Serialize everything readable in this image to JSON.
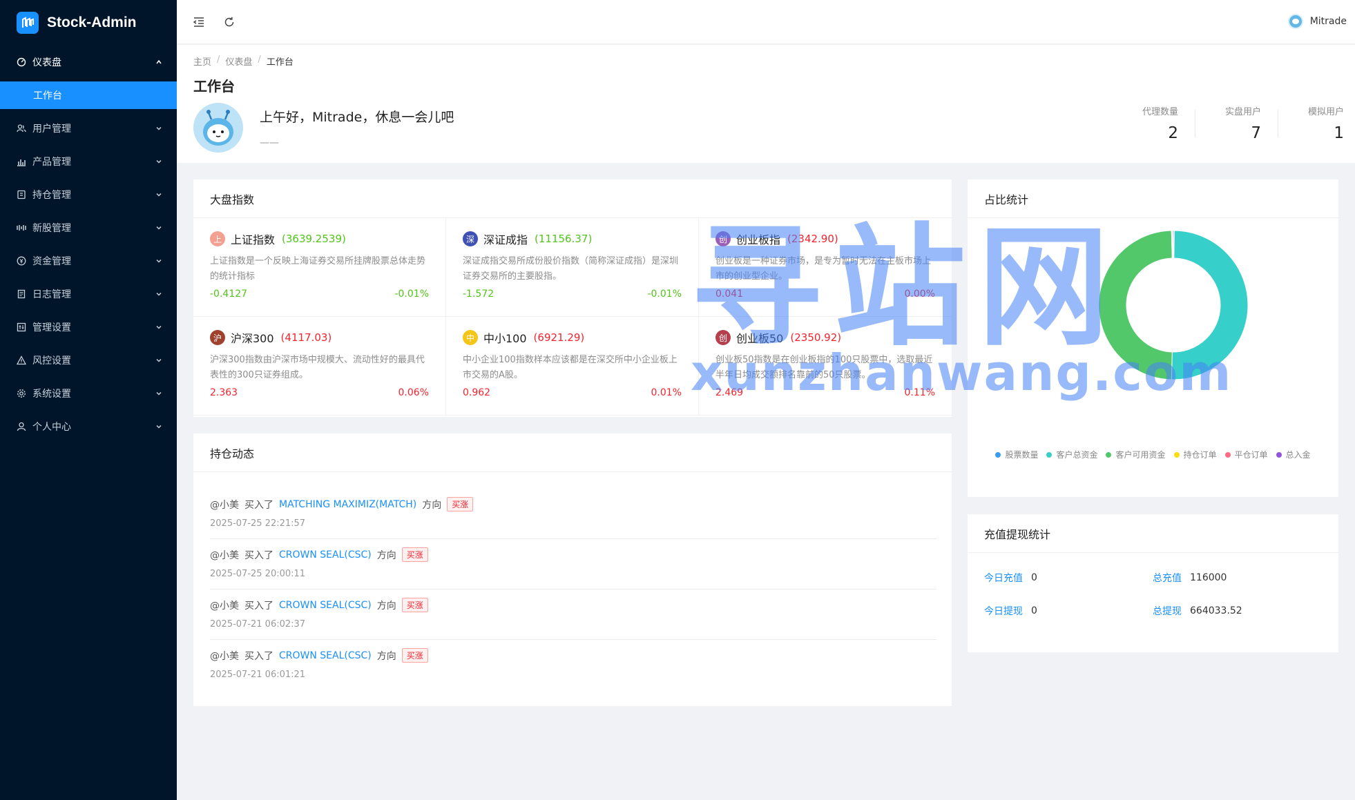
{
  "app": {
    "name": "Stock-Admin"
  },
  "sidebar": {
    "items": [
      {
        "label": "仪表盘",
        "icon": "dashboard-icon",
        "open": true
      },
      {
        "label": "用户管理",
        "icon": "users-icon"
      },
      {
        "label": "产品管理",
        "icon": "bar-chart-icon"
      },
      {
        "label": "持仓管理",
        "icon": "wallet-icon"
      },
      {
        "label": "新股管理",
        "icon": "new-stock-icon"
      },
      {
        "label": "资金管理",
        "icon": "money-icon"
      },
      {
        "label": "日志管理",
        "icon": "log-icon"
      },
      {
        "label": "管理设置",
        "icon": "settings-grid-icon"
      },
      {
        "label": "风控设置",
        "icon": "warning-icon"
      },
      {
        "label": "系统设置",
        "icon": "gear-icon"
      },
      {
        "label": "个人中心",
        "icon": "person-icon"
      }
    ],
    "submenu": {
      "label": "工作台"
    }
  },
  "header": {
    "username": "Mitrade"
  },
  "breadcrumb": [
    "主页",
    "仪表盘",
    "工作台"
  ],
  "page": {
    "title": "工作台",
    "greeting": "上午好，Mitrade，休息一会儿吧",
    "greeting_sub": "——",
    "stats": [
      {
        "label": "代理数量",
        "value": "2"
      },
      {
        "label": "实盘用户",
        "value": "7"
      },
      {
        "label": "模拟用户",
        "value": "1"
      }
    ]
  },
  "market": {
    "title": "大盘指数",
    "indices": [
      {
        "badge": "上",
        "badge_color": "#f4a090",
        "name": "上证指数",
        "price": "(3639.2539)",
        "desc": "上证指数是一个反映上海证券交易所挂牌股票总体走势的统计指标",
        "change": "-0.4127",
        "pct": "-0.01%",
        "trend": "down"
      },
      {
        "badge": "深",
        "badge_color": "#3f51b5",
        "name": "深证成指",
        "price": "(11156.37)",
        "desc": "深证成指交易所成份股价指数（简称深证成指）是深圳证券交易所的主要股指。",
        "change": "-1.572",
        "pct": "-0.01%",
        "trend": "down"
      },
      {
        "badge": "创",
        "badge_color": "#9c5fb5",
        "name": "创业板指",
        "price": "(2342.90)",
        "desc": "创业板是一种证券市场，是专为暂时无法在主板市场上市的创业型企业。",
        "change": "0.041",
        "pct": "0.00%",
        "trend": "up"
      },
      {
        "badge": "沪",
        "badge_color": "#a0412d",
        "name": "沪深300",
        "price": "(4117.03)",
        "desc": "沪深300指数由沪深市场中规模大、流动性好的最具代表性的300只证券组成。",
        "change": "2.363",
        "pct": "0.06%",
        "trend": "up"
      },
      {
        "badge": "中",
        "badge_color": "#f5c518",
        "name": "中小100",
        "price": "(6921.29)",
        "desc": "中小企业100指数样本应该都是在深交所中小企业板上市交易的A股。",
        "change": "0.962",
        "pct": "0.01%",
        "trend": "up"
      },
      {
        "badge": "创",
        "badge_color": "#b5404d",
        "name": "创业板50",
        "price": "(2350.92)",
        "desc": "创业板50指数是在创业板指的100只股票中，选取最近半年日均成交额排名靠前的50只股票。",
        "change": "2.469",
        "pct": "0.11%",
        "trend": "up"
      }
    ]
  },
  "positions": {
    "title": "持仓动态",
    "items": [
      {
        "user": "@小美",
        "action": "买入了",
        "product": "MATCHING MAXIMIZ(MATCH)",
        "dir_label": "方向",
        "tag": "买涨",
        "time": "2025-07-25 22:21:57"
      },
      {
        "user": "@小美",
        "action": "买入了",
        "product": "CROWN SEAL(CSC)",
        "dir_label": "方向",
        "tag": "买涨",
        "time": "2025-07-25 20:00:11"
      },
      {
        "user": "@小美",
        "action": "买入了",
        "product": "CROWN SEAL(CSC)",
        "dir_label": "方向",
        "tag": "买涨",
        "time": "2025-07-21 06:02:37"
      },
      {
        "user": "@小美",
        "action": "买入了",
        "product": "CROWN SEAL(CSC)",
        "dir_label": "方向",
        "tag": "买涨",
        "time": "2025-07-21 06:01:21"
      }
    ]
  },
  "ratio": {
    "title": "占比统计",
    "legend": [
      {
        "label": "股票数量",
        "color": "#3a9cf5"
      },
      {
        "label": "客户总资金",
        "color": "#36cfc9"
      },
      {
        "label": "客户可用资金",
        "color": "#52c86b"
      },
      {
        "label": "持仓订单",
        "color": "#fadb14"
      },
      {
        "label": "平仓订单",
        "color": "#ff6b81"
      },
      {
        "label": "总入金",
        "color": "#9254de"
      }
    ],
    "chart_data": {
      "type": "pie",
      "categories": [
        "股票数量",
        "客户总资金",
        "客户可用资金",
        "持仓订单",
        "平仓订单",
        "总入金"
      ],
      "values": [
        0.2,
        50.2,
        49.2,
        0.1,
        0.1,
        0.2
      ]
    }
  },
  "recharge": {
    "title": "充值提现统计",
    "items": [
      {
        "label": "今日充值",
        "value": "0"
      },
      {
        "label": "总充值",
        "value": "116000"
      },
      {
        "label": "今日提现",
        "value": "0"
      },
      {
        "label": "总提现",
        "value": "664033.52"
      }
    ]
  },
  "watermark": {
    "cn": "寻站网",
    "en": "xunzhanwang.com"
  }
}
